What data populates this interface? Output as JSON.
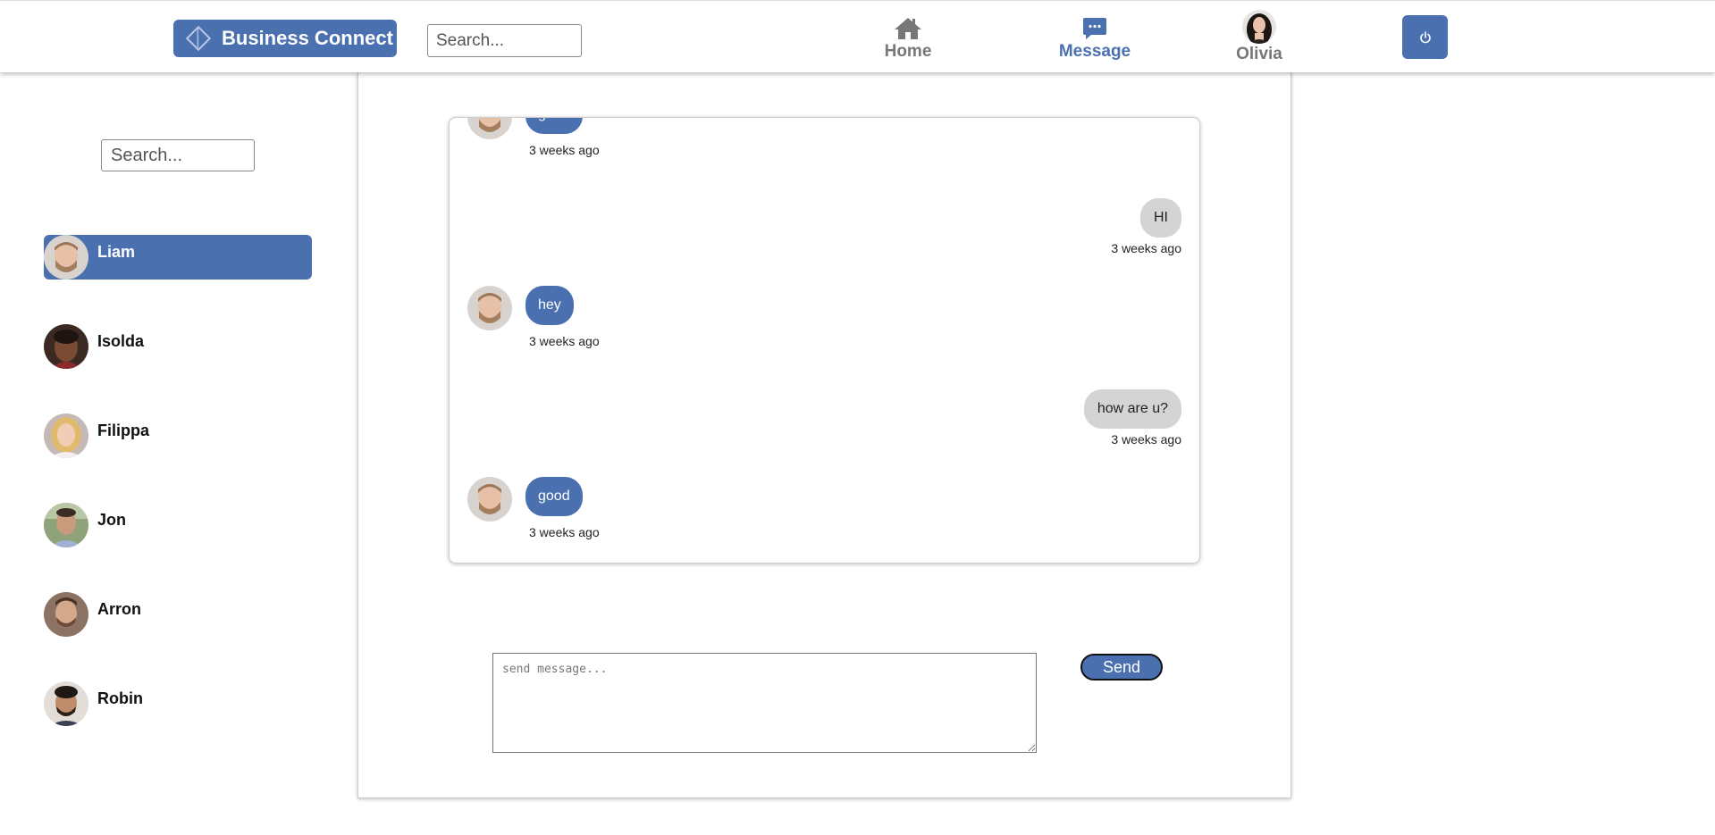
{
  "header": {
    "brand": "Business Connect",
    "search_placeholder": "Search...",
    "nav": {
      "home": "Home",
      "message": "Message",
      "profile": "Olivia"
    }
  },
  "sidebar": {
    "search_placeholder": "Search...",
    "contacts": [
      {
        "name": "Liam",
        "active": true
      },
      {
        "name": "Isolda",
        "active": false
      },
      {
        "name": "Filippa",
        "active": false
      },
      {
        "name": "Jon",
        "active": false
      },
      {
        "name": "Arron",
        "active": false
      },
      {
        "name": "Robin",
        "active": false
      }
    ]
  },
  "chat": {
    "messages": [
      {
        "from": "Liam",
        "direction": "incoming",
        "text": "good",
        "time": "3 weeks ago"
      },
      {
        "from": "me",
        "direction": "outgoing",
        "text": "HI",
        "time": "3 weeks ago"
      },
      {
        "from": "Liam",
        "direction": "incoming",
        "text": "hey",
        "time": "3 weeks ago"
      },
      {
        "from": "me",
        "direction": "outgoing",
        "text": "how are u?",
        "time": "3 weeks ago"
      },
      {
        "from": "Liam",
        "direction": "incoming",
        "text": "good",
        "time": "3 weeks ago"
      }
    ],
    "compose_placeholder": "send message...",
    "send_label": "Send"
  },
  "colors": {
    "accent": "#4a70b0",
    "outgoing_bubble": "#d4d4d4",
    "nav_inactive": "#777777"
  },
  "icons": {
    "home": "home-icon",
    "message": "chat-bubble-icon",
    "logout": "power-icon"
  }
}
